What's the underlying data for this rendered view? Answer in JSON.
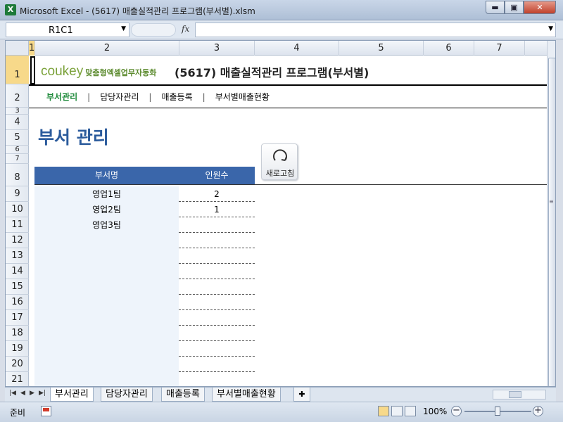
{
  "window": {
    "app_icon": "X",
    "title": "Microsoft Excel - (5617) 매출실적관리 프로그램(부서별).xlsm",
    "min_icon": "▬",
    "max_icon": "▣",
    "close_icon": "✕"
  },
  "formula_bar": {
    "name_box": "R1C1",
    "fx_label": "fx",
    "formula": ""
  },
  "columns": [
    "1",
    "2",
    "3",
    "4",
    "5",
    "6",
    "7"
  ],
  "rows": [
    "1",
    "2",
    "3",
    "4",
    "5",
    "6",
    "7",
    "8",
    "9",
    "10",
    "11",
    "12",
    "13",
    "14",
    "15",
    "16",
    "17",
    "18",
    "19",
    "20",
    "21"
  ],
  "sheet": {
    "logo_brand": "coukey",
    "logo_sub": "맞춤형엑셀업무자동화",
    "program_title": "(5617) 매출실적관리 프로그램(부서별)",
    "menu": [
      "부서관리",
      "담당자관리",
      "매출등록",
      "부서별매출현황"
    ],
    "menu_separator": "|",
    "page_title": "부서 관리",
    "refresh_label": "새로고침",
    "table": {
      "headers": [
        "부서명",
        "인원수"
      ],
      "rows": [
        {
          "name": "영업1팀",
          "count": "2"
        },
        {
          "name": "영업2팀",
          "count": "1"
        },
        {
          "name": "영업3팀",
          "count": ""
        },
        {
          "name": "",
          "count": ""
        },
        {
          "name": "",
          "count": ""
        },
        {
          "name": "",
          "count": ""
        },
        {
          "name": "",
          "count": ""
        },
        {
          "name": "",
          "count": ""
        },
        {
          "name": "",
          "count": ""
        },
        {
          "name": "",
          "count": ""
        },
        {
          "name": "",
          "count": ""
        },
        {
          "name": "",
          "count": ""
        },
        {
          "name": "",
          "count": ""
        }
      ]
    }
  },
  "tabs": [
    "부서관리",
    "담당자관리",
    "매출등록",
    "부서별매출현황"
  ],
  "active_tab": "부서관리",
  "status": {
    "ready": "준비",
    "zoom": "100%"
  },
  "colors": {
    "accent_blue": "#3a66aa",
    "title_blue": "#2b5b9c",
    "menu_green": "#1e8a3a",
    "brand_green": "#7ba23a"
  }
}
